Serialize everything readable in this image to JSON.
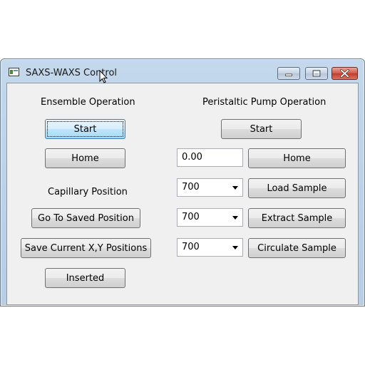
{
  "window": {
    "title": "SAXS-WAXS Control"
  },
  "ensemble": {
    "heading": "Ensemble Operation",
    "start_label": "Start",
    "home_label": "Home"
  },
  "capillary": {
    "heading": "Capillary Position",
    "go_saved_label": "Go To Saved Position",
    "save_current_label": "Save Current X,Y Positions",
    "inserted_label": "Inserted"
  },
  "pump": {
    "heading": "Peristaltic Pump Operation",
    "start_label": "Start",
    "position_value": "0.00",
    "home_label": "Home",
    "load_speed": "700",
    "load_label": "Load Sample",
    "extract_speed": "700",
    "extract_label": "Extract Sample",
    "circulate_speed": "700",
    "circulate_label": "Circulate Sample"
  },
  "colors": {
    "titlebar": "#c4d8ec",
    "client_bg": "#f0f0f0",
    "close_button": "#c13b2b",
    "focus_border": "#3c7fb1"
  }
}
